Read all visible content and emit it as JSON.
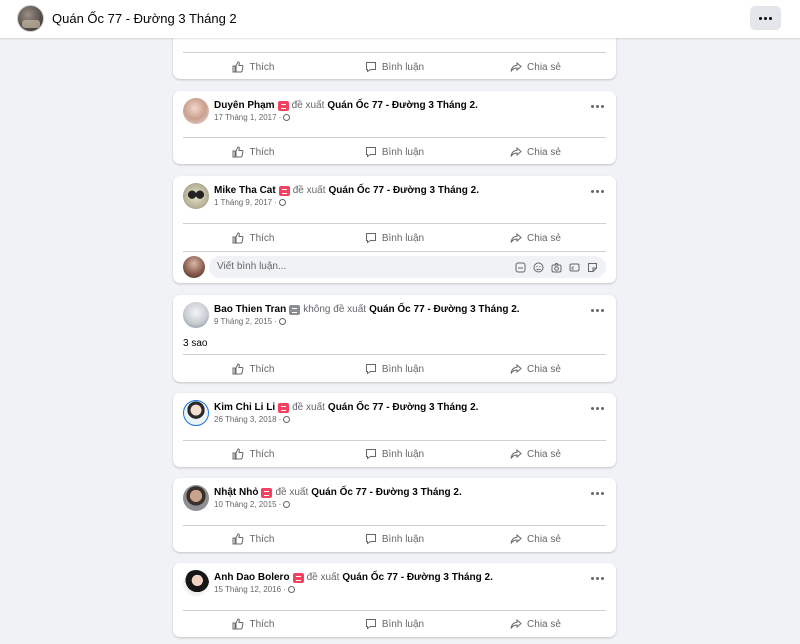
{
  "header": {
    "title": "Quán Ốc 77 - Đường 3 Tháng 2",
    "more_icon": "more-dots-icon"
  },
  "actions": {
    "like": "Thích",
    "comment": "Bình luận",
    "share": "Chia sẻ"
  },
  "comment_box": {
    "placeholder": "Viết bình luận...",
    "icons": [
      "sticker-icon",
      "emoji-icon",
      "camera-icon",
      "gif-icon",
      "sticker-face-icon"
    ]
  },
  "reviews": [
    {
      "user": "Duyên Phạm",
      "verb": "đề xuất",
      "page": "Quán Ốc 77 - Đường 3 Tháng 2.",
      "date": "17 Tháng 1, 2017",
      "recommend": true
    },
    {
      "user": "Mike Tha Cat",
      "verb": "đề xuất",
      "page": "Quán Ốc 77 - Đường 3 Tháng 2.",
      "date": "1 Tháng 9, 2017",
      "recommend": true
    },
    {
      "user": "Bao Thien Tran",
      "verb": "không đề xuất",
      "page": "Quán Ốc 77 - Đường 3 Tháng 2.",
      "date": "9 Tháng 2, 2015",
      "recommend": false,
      "text": "3 sao"
    },
    {
      "user": "Kim Chi Li Li",
      "verb": "đề xuất",
      "page": "Quán Ốc 77 - Đường 3 Tháng 2.",
      "date": "26 Tháng 3, 2018",
      "recommend": true
    },
    {
      "user": "Nhật Nhỏ",
      "verb": "đề xuất",
      "page": "Quán Ốc 77 - Đường 3 Tháng 2.",
      "date": "10 Tháng 2, 2015",
      "recommend": true
    },
    {
      "user": "Anh Dao Bolero",
      "verb": "đề xuất",
      "page": "Quán Ốc 77 - Đường 3 Tháng 2.",
      "date": "15 Tháng 12, 2016",
      "recommend": true
    }
  ]
}
